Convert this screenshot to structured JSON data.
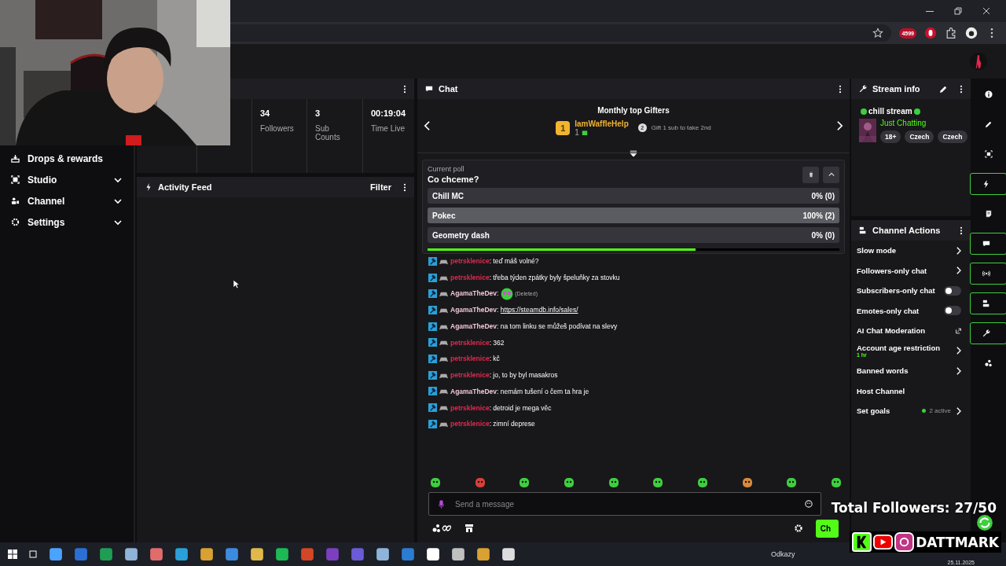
{
  "browser": {
    "extension_badge": "4599"
  },
  "sidebar": {
    "items": [
      {
        "label": "Drops & rewards",
        "expandable": false
      },
      {
        "label": "Studio",
        "expandable": true
      },
      {
        "label": "Channel",
        "expandable": true
      },
      {
        "label": "Settings",
        "expandable": true
      }
    ]
  },
  "stats": [
    {
      "value": "34",
      "label": "Followers"
    },
    {
      "value": "3",
      "label": "Sub Counts"
    },
    {
      "value": "00:19:04",
      "label": "Time Live"
    }
  ],
  "activity_feed": {
    "title": "Activity Feed",
    "filter": "Filter"
  },
  "chat": {
    "title": "Chat",
    "gifters": {
      "title": "Monthly top Gifters",
      "rank": "1",
      "name": "IamWaffleHelp",
      "count": "1",
      "next_rank": "2",
      "next_hint": "Gift 1 sub to take 2nd"
    },
    "poll": {
      "caption": "Current poll",
      "question": "Co chceme?",
      "timer": {
        "level": 0.65
      },
      "options": [
        {
          "label": "Chill MC",
          "result": "0% (0)",
          "level": 0
        },
        {
          "label": "Pokec",
          "result": "100% (2)",
          "level": 1
        },
        {
          "label": "Geometry dash",
          "result": "0% (0)",
          "level": 0
        }
      ]
    },
    "messages": [
      {
        "user": "petrsklenice",
        "sep": ":",
        "color": "#e0294d",
        "kind": "text",
        "text": "teď máš volné?"
      },
      {
        "user": "petrsklenice",
        "sep": ":",
        "color": "#e0294d",
        "kind": "text",
        "text": "třeba týden zpátky byly špeluňky za stovku"
      },
      {
        "user": "AgamaTheDev",
        "sep": ":",
        "color": "#f2c6d6",
        "kind": "deleted",
        "text": "(Deleted)"
      },
      {
        "user": "AgamaTheDev",
        "sep": ":",
        "color": "#f2c6d6",
        "kind": "link",
        "text": "https://steamdb.info/sales/"
      },
      {
        "user": "AgamaTheDev",
        "sep": ":",
        "color": "#f2c6d6",
        "kind": "text",
        "text": "na tom linku se můžeš podívat na slevy"
      },
      {
        "user": "petrsklenice",
        "sep": ":",
        "color": "#e0294d",
        "kind": "text",
        "text": "362"
      },
      {
        "user": "petrsklenice",
        "sep": ":",
        "color": "#e0294d",
        "kind": "text",
        "text": "kč"
      },
      {
        "user": "petrsklenice",
        "sep": ":",
        "color": "#e0294d",
        "kind": "text",
        "text": "jo, to by byl masakros"
      },
      {
        "user": "AgamaTheDev",
        "sep": ":",
        "color": "#f2c6d6",
        "kind": "text",
        "text": "nemám tušení o čem ta hra je"
      },
      {
        "user": "petrsklenice",
        "sep": ":",
        "color": "#e0294d",
        "kind": "text",
        "text": "detroid je mega věc"
      },
      {
        "user": "petrsklenice",
        "sep": ":",
        "color": "#e0294d",
        "kind": "text",
        "text": "zimní deprese"
      }
    ],
    "emotes": [
      {
        "color": "#3ecf3e"
      },
      {
        "color": "#d9403a"
      },
      {
        "color": "#3ecf3e"
      },
      {
        "color": "#3ecf3e"
      },
      {
        "color": "#3ecf3e"
      },
      {
        "color": "#3ecf3e"
      },
      {
        "color": "#3ecf3e"
      },
      {
        "color": "#d98a3a"
      },
      {
        "color": "#3ecf3e"
      },
      {
        "color": "#3ecf3e"
      }
    ],
    "input": {
      "placeholder": "Send a message"
    },
    "send_button": "Ch"
  },
  "stream_info": {
    "title": "Stream info",
    "stream_title": "chill stream",
    "category": "Just Chatting",
    "tags": [
      "18+",
      "Czech",
      "Czech"
    ]
  },
  "channel_actions": {
    "title": "Channel Actions",
    "items": [
      {
        "label": "Slow mode",
        "kind": "arrow"
      },
      {
        "label": "Followers-only chat",
        "kind": "arrow"
      },
      {
        "label": "Subscribers-only chat",
        "kind": "toggle",
        "on": false
      },
      {
        "label": "Emotes-only chat",
        "kind": "toggle",
        "on": false
      },
      {
        "label": "AI Chat Moderation",
        "kind": "external"
      },
      {
        "label": "Account age restriction",
        "kind": "arrow",
        "sub": "1 hr"
      },
      {
        "label": "Banned words",
        "kind": "arrow"
      },
      {
        "label": "Host Channel",
        "kind": "plain"
      },
      {
        "label": "Set goals",
        "kind": "arrow",
        "status": "2 active"
      }
    ]
  },
  "rail": [
    {
      "active": false
    },
    {
      "active": false
    },
    {
      "active": false
    },
    {
      "active": true
    },
    {
      "active": false
    },
    {
      "active": true
    },
    {
      "active": true
    },
    {
      "active": true
    },
    {
      "active": true
    },
    {
      "active": false
    }
  ],
  "overlay": {
    "followers": "Total Followers: 27/50",
    "brand": "DATTMARK"
  },
  "taskbar": {
    "links": "Odkazy",
    "date": "25.11.2025"
  }
}
